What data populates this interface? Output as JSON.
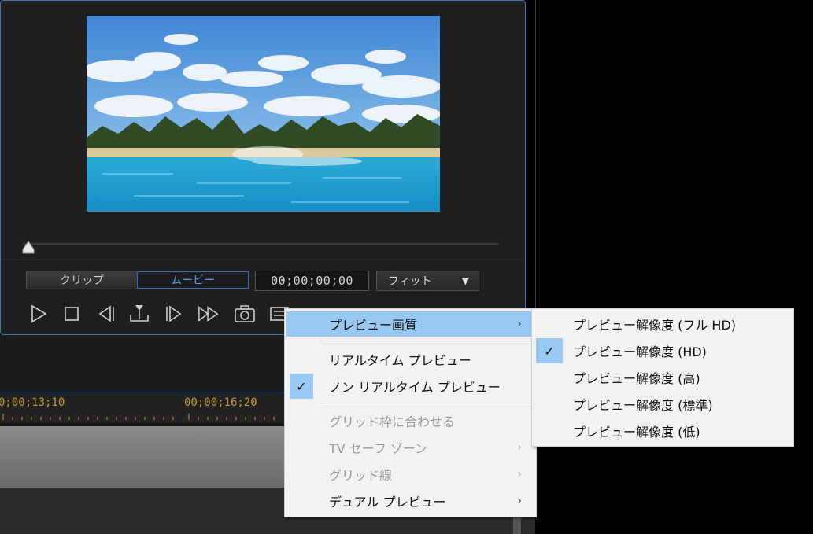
{
  "preview": {
    "mode_buttons": [
      {
        "label": "クリップ",
        "active": false
      },
      {
        "label": "ムービー",
        "active": true
      }
    ],
    "timecode": "00;00;00;00",
    "fit_label": "フィット",
    "scrub_position": 0
  },
  "toolbar_icons": [
    "play-icon",
    "stop-icon",
    "previous-frame-icon",
    "split-icon",
    "next-frame-icon",
    "fast-forward-icon",
    "snapshot-camera-icon",
    "preview-settings-icon",
    "volume-icon",
    "3d-icon",
    "display-icon"
  ],
  "timeline": {
    "times": [
      "0;00;13;10",
      "00;00;16;20"
    ]
  },
  "context_menu": {
    "items": [
      {
        "label": "プレビュー画質",
        "has_submenu": true,
        "highlighted": true
      },
      {
        "label": "リアルタイム プレビュー",
        "checked": false
      },
      {
        "label": "ノン リアルタイム プレビュー",
        "checked": true
      },
      {
        "label": "グリッド枠に合わせる",
        "disabled": true
      },
      {
        "label": "TV セーフ ゾーン",
        "disabled": true,
        "has_submenu": true
      },
      {
        "label": "グリッド線",
        "disabled": true,
        "has_submenu": true
      },
      {
        "label": "デュアル プレビュー",
        "has_submenu": true
      }
    ]
  },
  "submenu": {
    "items": [
      {
        "label": "プレビュー解像度 (フル HD)",
        "checked": false
      },
      {
        "label": "プレビュー解像度 (HD)",
        "checked": true
      },
      {
        "label": "プレビュー解像度 (高)",
        "checked": false
      },
      {
        "label": "プレビュー解像度 (標準)",
        "checked": false
      },
      {
        "label": "プレビュー解像度 (低)",
        "checked": false
      }
    ]
  },
  "colors": {
    "accent": "#3b74b8",
    "menu_highlight": "#99c9f2",
    "timecode_orange": "#c79a2c"
  },
  "glyphs": {
    "check": "✓",
    "chevron_right": "›",
    "dropdown_arrow": "▼"
  }
}
